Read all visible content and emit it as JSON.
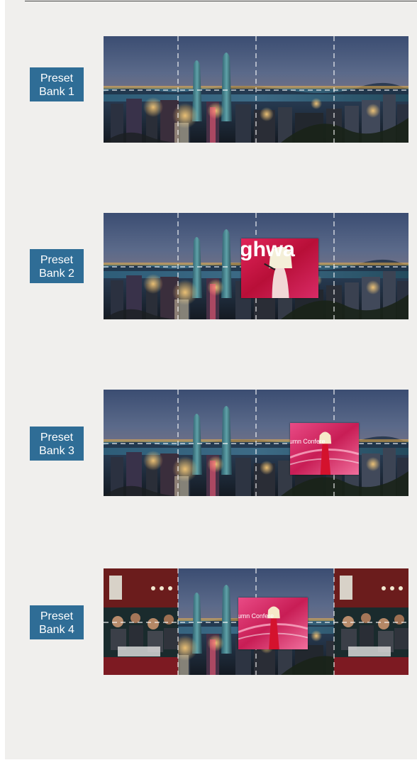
{
  "presets": [
    {
      "label": "Preset\nBank 1",
      "window": "none"
    },
    {
      "label": "Preset\nBank 2",
      "window": "stage-speaker"
    },
    {
      "label": "Preset\nBank 3",
      "window": "red-stage-speaker"
    },
    {
      "label": "Preset\nBank 4",
      "window": "red-stage-speaker-with-audience"
    }
  ],
  "colors": {
    "label_bg": "#2f6d96",
    "panel_bg": "#f0efed",
    "grid_line": "#ffffff",
    "stage_red": "#c8143a"
  },
  "icons": {
    "cityscape": "city-night-skyline-image",
    "stage": "stage-speaker-image",
    "audience": "conference-audience-image"
  },
  "text": {
    "stage_sign": "ghwa",
    "banner_text": "umn Confere"
  }
}
